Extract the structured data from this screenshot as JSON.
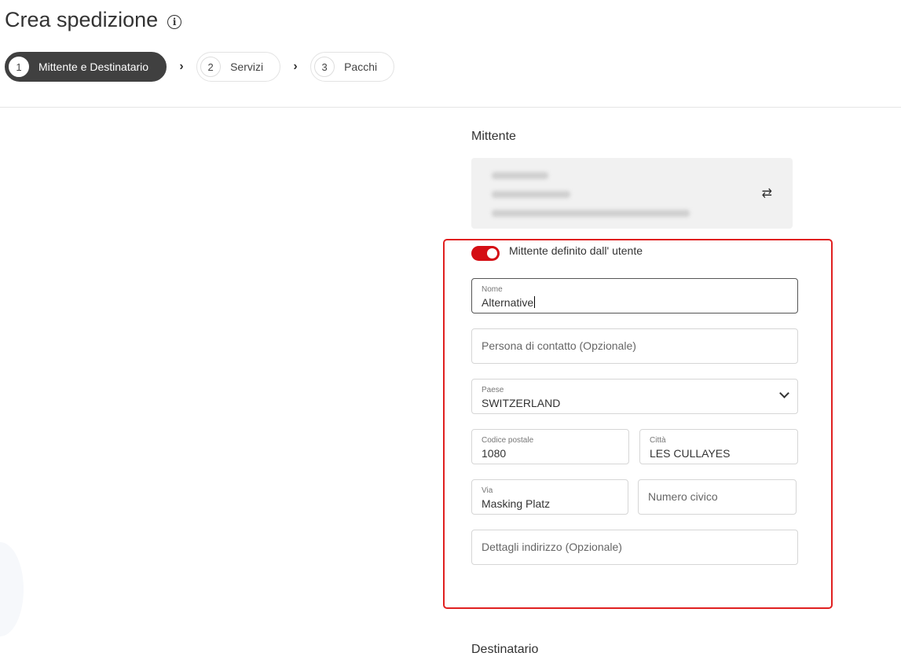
{
  "page": {
    "title": "Crea spedizione"
  },
  "stepper": [
    {
      "num": "1",
      "label": "Mittente e Destinatario"
    },
    {
      "num": "2",
      "label": "Servizi"
    },
    {
      "num": "3",
      "label": "Pacchi"
    }
  ],
  "sender": {
    "section_title": "Mittente"
  },
  "toggle": {
    "label": "Mittente definito dall' utente",
    "on": true
  },
  "form": {
    "nome": {
      "label": "Nome",
      "value": "Alternative"
    },
    "contatto": {
      "placeholder": "Persona di contatto (Opzionale)"
    },
    "paese": {
      "label": "Paese",
      "value": "SWITZERLAND"
    },
    "cap": {
      "label": "Codice postale",
      "value": "1080"
    },
    "citta": {
      "label": "Città",
      "value": "LES CULLAYES"
    },
    "via": {
      "label": "Via",
      "value": "Masking Platz"
    },
    "civico": {
      "placeholder": "Numero civico"
    },
    "dettagli": {
      "placeholder": "Dettagli indirizzo (Opzionale)"
    }
  },
  "recipient": {
    "section_title": "Destinatario"
  },
  "colors": {
    "accent": "#d40e14",
    "highlight": "#e02020",
    "active_step": "#404040"
  }
}
